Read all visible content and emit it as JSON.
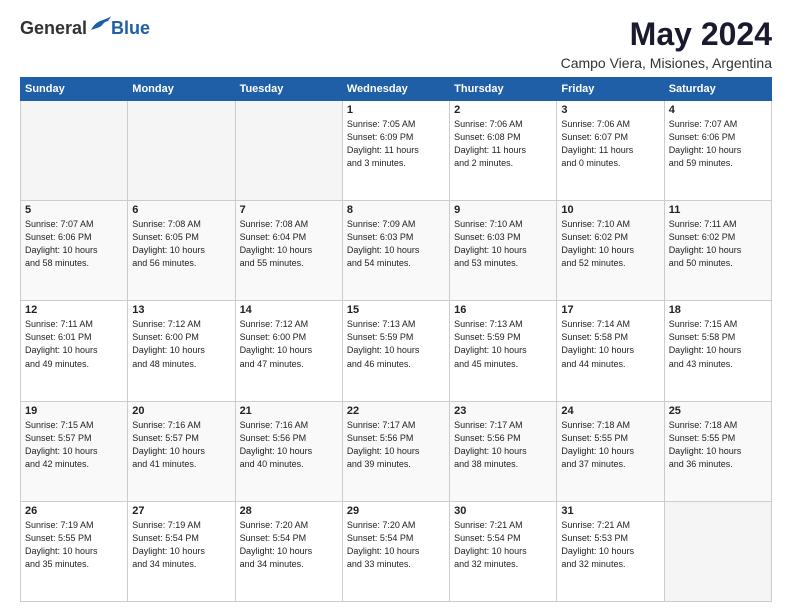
{
  "logo": {
    "general": "General",
    "blue": "Blue"
  },
  "title": "May 2024",
  "subtitle": "Campo Viera, Misiones, Argentina",
  "days_header": [
    "Sunday",
    "Monday",
    "Tuesday",
    "Wednesday",
    "Thursday",
    "Friday",
    "Saturday"
  ],
  "weeks": [
    [
      {
        "day": "",
        "info": ""
      },
      {
        "day": "",
        "info": ""
      },
      {
        "day": "",
        "info": ""
      },
      {
        "day": "1",
        "info": "Sunrise: 7:05 AM\nSunset: 6:09 PM\nDaylight: 11 hours\nand 3 minutes."
      },
      {
        "day": "2",
        "info": "Sunrise: 7:06 AM\nSunset: 6:08 PM\nDaylight: 11 hours\nand 2 minutes."
      },
      {
        "day": "3",
        "info": "Sunrise: 7:06 AM\nSunset: 6:07 PM\nDaylight: 11 hours\nand 0 minutes."
      },
      {
        "day": "4",
        "info": "Sunrise: 7:07 AM\nSunset: 6:06 PM\nDaylight: 10 hours\nand 59 minutes."
      }
    ],
    [
      {
        "day": "5",
        "info": "Sunrise: 7:07 AM\nSunset: 6:06 PM\nDaylight: 10 hours\nand 58 minutes."
      },
      {
        "day": "6",
        "info": "Sunrise: 7:08 AM\nSunset: 6:05 PM\nDaylight: 10 hours\nand 56 minutes."
      },
      {
        "day": "7",
        "info": "Sunrise: 7:08 AM\nSunset: 6:04 PM\nDaylight: 10 hours\nand 55 minutes."
      },
      {
        "day": "8",
        "info": "Sunrise: 7:09 AM\nSunset: 6:03 PM\nDaylight: 10 hours\nand 54 minutes."
      },
      {
        "day": "9",
        "info": "Sunrise: 7:10 AM\nSunset: 6:03 PM\nDaylight: 10 hours\nand 53 minutes."
      },
      {
        "day": "10",
        "info": "Sunrise: 7:10 AM\nSunset: 6:02 PM\nDaylight: 10 hours\nand 52 minutes."
      },
      {
        "day": "11",
        "info": "Sunrise: 7:11 AM\nSunset: 6:02 PM\nDaylight: 10 hours\nand 50 minutes."
      }
    ],
    [
      {
        "day": "12",
        "info": "Sunrise: 7:11 AM\nSunset: 6:01 PM\nDaylight: 10 hours\nand 49 minutes."
      },
      {
        "day": "13",
        "info": "Sunrise: 7:12 AM\nSunset: 6:00 PM\nDaylight: 10 hours\nand 48 minutes."
      },
      {
        "day": "14",
        "info": "Sunrise: 7:12 AM\nSunset: 6:00 PM\nDaylight: 10 hours\nand 47 minutes."
      },
      {
        "day": "15",
        "info": "Sunrise: 7:13 AM\nSunset: 5:59 PM\nDaylight: 10 hours\nand 46 minutes."
      },
      {
        "day": "16",
        "info": "Sunrise: 7:13 AM\nSunset: 5:59 PM\nDaylight: 10 hours\nand 45 minutes."
      },
      {
        "day": "17",
        "info": "Sunrise: 7:14 AM\nSunset: 5:58 PM\nDaylight: 10 hours\nand 44 minutes."
      },
      {
        "day": "18",
        "info": "Sunrise: 7:15 AM\nSunset: 5:58 PM\nDaylight: 10 hours\nand 43 minutes."
      }
    ],
    [
      {
        "day": "19",
        "info": "Sunrise: 7:15 AM\nSunset: 5:57 PM\nDaylight: 10 hours\nand 42 minutes."
      },
      {
        "day": "20",
        "info": "Sunrise: 7:16 AM\nSunset: 5:57 PM\nDaylight: 10 hours\nand 41 minutes."
      },
      {
        "day": "21",
        "info": "Sunrise: 7:16 AM\nSunset: 5:56 PM\nDaylight: 10 hours\nand 40 minutes."
      },
      {
        "day": "22",
        "info": "Sunrise: 7:17 AM\nSunset: 5:56 PM\nDaylight: 10 hours\nand 39 minutes."
      },
      {
        "day": "23",
        "info": "Sunrise: 7:17 AM\nSunset: 5:56 PM\nDaylight: 10 hours\nand 38 minutes."
      },
      {
        "day": "24",
        "info": "Sunrise: 7:18 AM\nSunset: 5:55 PM\nDaylight: 10 hours\nand 37 minutes."
      },
      {
        "day": "25",
        "info": "Sunrise: 7:18 AM\nSunset: 5:55 PM\nDaylight: 10 hours\nand 36 minutes."
      }
    ],
    [
      {
        "day": "26",
        "info": "Sunrise: 7:19 AM\nSunset: 5:55 PM\nDaylight: 10 hours\nand 35 minutes."
      },
      {
        "day": "27",
        "info": "Sunrise: 7:19 AM\nSunset: 5:54 PM\nDaylight: 10 hours\nand 34 minutes."
      },
      {
        "day": "28",
        "info": "Sunrise: 7:20 AM\nSunset: 5:54 PM\nDaylight: 10 hours\nand 34 minutes."
      },
      {
        "day": "29",
        "info": "Sunrise: 7:20 AM\nSunset: 5:54 PM\nDaylight: 10 hours\nand 33 minutes."
      },
      {
        "day": "30",
        "info": "Sunrise: 7:21 AM\nSunset: 5:54 PM\nDaylight: 10 hours\nand 32 minutes."
      },
      {
        "day": "31",
        "info": "Sunrise: 7:21 AM\nSunset: 5:53 PM\nDaylight: 10 hours\nand 32 minutes."
      },
      {
        "day": "",
        "info": ""
      }
    ]
  ]
}
